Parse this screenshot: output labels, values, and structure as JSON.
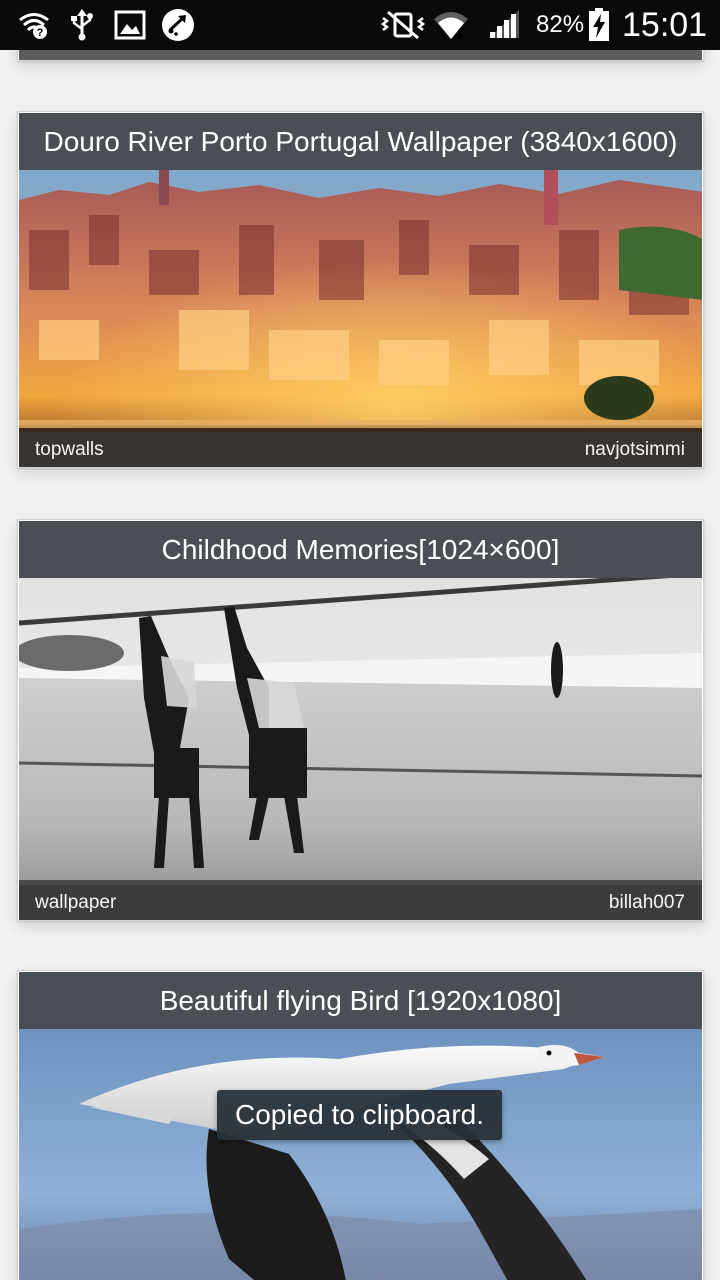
{
  "status_bar": {
    "battery_percent": "82%",
    "time": "15:01",
    "left_icons": [
      "wifi-question-icon",
      "usb-icon",
      "image-icon",
      "sync-icon"
    ],
    "right_icons": [
      "vibrate-mute-icon",
      "wifi-icon",
      "cell-signal-icon",
      "battery-charging-icon"
    ]
  },
  "wallpapers": [
    {
      "title": "Douro River Porto Portugal Wallpaper (3840x1600)",
      "category": "topwalls",
      "user": "navjotsimmi"
    },
    {
      "title": "Childhood Memories[1024×600]",
      "category": "wallpaper",
      "user": "billah007"
    },
    {
      "title": "Beautiful flying Bird [1920x1080]"
    }
  ],
  "toast": {
    "message": "Copied to clipboard."
  },
  "colors": {
    "title_bar": "#4a4f55",
    "footer_overlay": "#373737",
    "toast_bg": "#283038",
    "status_bar": "#0a0a0a"
  }
}
